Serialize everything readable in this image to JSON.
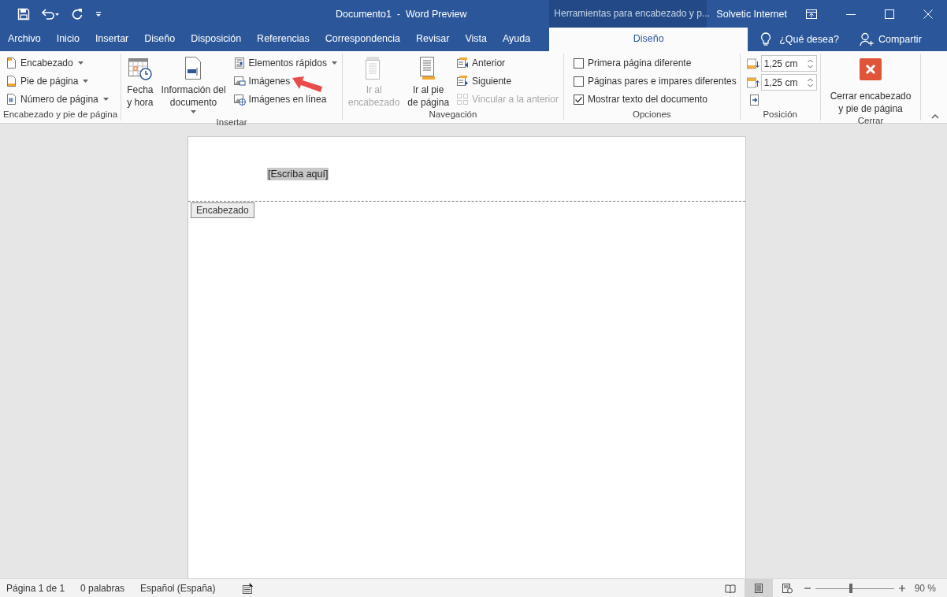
{
  "title_bar": {
    "title": "Documento1  -  Word Preview",
    "context_tools": "Herramientas para encabezado y p...",
    "user": "Solvetic Internet"
  },
  "menu_tabs": [
    {
      "label": "Archivo",
      "selected": false
    },
    {
      "label": "Inicio",
      "selected": false
    },
    {
      "label": "Insertar",
      "selected": false
    },
    {
      "label": "Diseño",
      "selected": false
    },
    {
      "label": "Disposición",
      "selected": false
    },
    {
      "label": "Referencias",
      "selected": false
    },
    {
      "label": "Correspondencia",
      "selected": false
    },
    {
      "label": "Revisar",
      "selected": false
    },
    {
      "label": "Vista",
      "selected": false
    },
    {
      "label": "Ayuda",
      "selected": false
    },
    {
      "label": "Diseño",
      "selected": true,
      "kind": "context"
    }
  ],
  "tell_me": "¿Qué desea?",
  "share": "Compartir",
  "ribbon": {
    "groups": [
      {
        "label": "Encabezado y pie de página",
        "items": [
          {
            "kind": "small",
            "label": "Encabezado",
            "dropdown": true,
            "disabled": false
          },
          {
            "kind": "small",
            "label": "Pie de página",
            "dropdown": true,
            "disabled": false
          },
          {
            "kind": "small",
            "label": "Número de página",
            "dropdown": true,
            "disabled": false
          }
        ]
      },
      {
        "label": "Insertar",
        "items": [
          {
            "kind": "large",
            "lines": [
              "Fecha",
              "y hora"
            ],
            "dropdown": false,
            "disabled": false
          },
          {
            "kind": "large",
            "lines": [
              "Información del",
              "documento"
            ],
            "dropdown": true,
            "disabled": false
          },
          {
            "kind": "small",
            "label": "Elementos rápidos",
            "dropdown": true,
            "disabled": false
          },
          {
            "kind": "small",
            "label": "Imágenes",
            "dropdown": false,
            "disabled": false
          },
          {
            "kind": "small",
            "label": "Imágenes en línea",
            "dropdown": false,
            "disabled": false
          }
        ]
      },
      {
        "label": "Navegación",
        "items": [
          {
            "kind": "large",
            "lines": [
              "Ir al",
              "encabezado"
            ],
            "dropdown": false,
            "disabled": true
          },
          {
            "kind": "large",
            "lines": [
              "Ir al pie",
              "de página"
            ],
            "dropdown": false,
            "disabled": false
          },
          {
            "kind": "small",
            "label": "Anterior",
            "dropdown": false,
            "disabled": false
          },
          {
            "kind": "small",
            "label": "Siguiente",
            "dropdown": false,
            "disabled": false
          },
          {
            "kind": "small",
            "label": "Vincular a la anterior",
            "dropdown": false,
            "disabled": true
          }
        ]
      },
      {
        "label": "Opciones",
        "items": [
          {
            "kind": "check",
            "label": "Primera página diferente",
            "checked": false
          },
          {
            "kind": "check",
            "label": "Páginas pares e impares diferentes",
            "checked": false
          },
          {
            "kind": "check",
            "label": "Mostrar texto del documento",
            "checked": true
          }
        ]
      },
      {
        "label": "Posición",
        "items": [
          {
            "kind": "spin",
            "value": "1,25 cm"
          },
          {
            "kind": "spin",
            "value": "1,25 cm"
          },
          {
            "kind": "icon"
          }
        ]
      },
      {
        "label": "Cerrar",
        "items": [
          {
            "kind": "close",
            "lines": [
              "Cerrar encabezado",
              "y pie de página"
            ]
          }
        ]
      }
    ]
  },
  "document": {
    "header_placeholder": "[Escriba aquí]",
    "header_tag": "Encabezado"
  },
  "status_bar": {
    "page": "Página 1 de 1",
    "words": "0 palabras",
    "language": "Español (España)",
    "views": [
      {
        "selected": false
      },
      {
        "selected": true
      },
      {
        "selected": false
      }
    ],
    "zoom": {
      "level": 0.45,
      "reading": "90 %"
    }
  }
}
